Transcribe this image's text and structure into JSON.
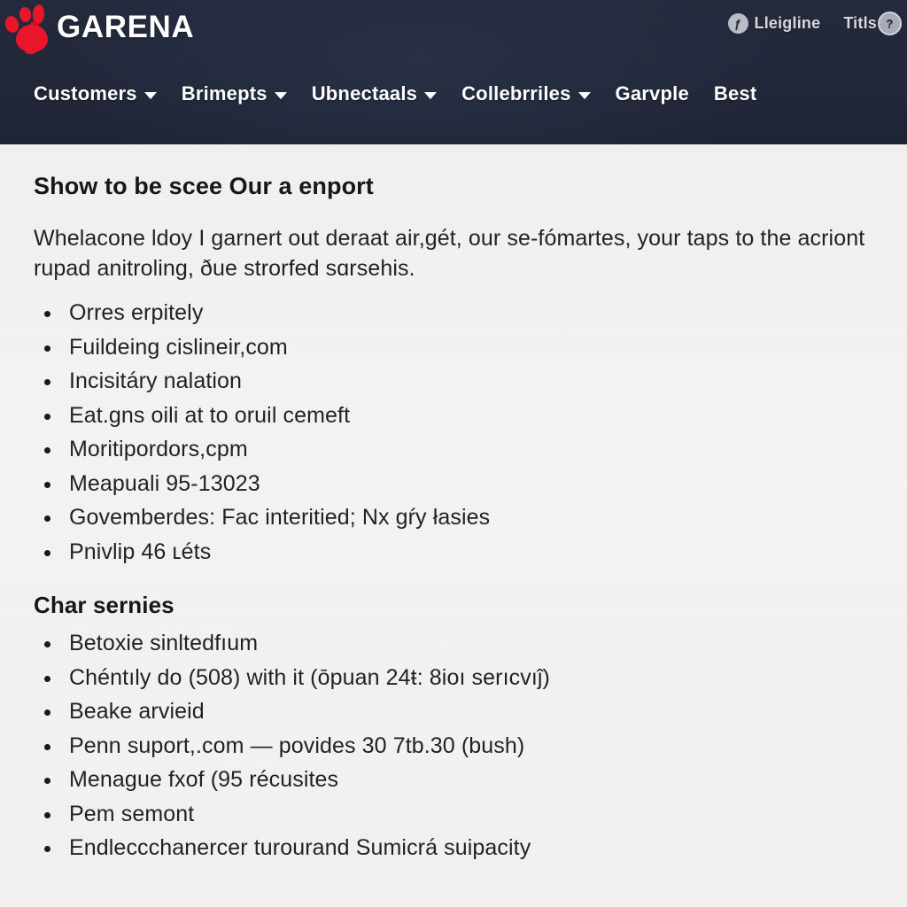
{
  "header": {
    "brand": "GARENA",
    "logo_icon": "paw-logo-icon",
    "brand_color": "#e8152b",
    "background_color": "#22283a",
    "utility": [
      {
        "icon": "person-circle-icon",
        "icon_glyph": "ƒ",
        "label": "Lleigline"
      },
      {
        "icon": "question-circle-icon",
        "icon_glyph": "?",
        "label": "Titls"
      }
    ],
    "nav": [
      {
        "label": "Customers",
        "has_caret": true
      },
      {
        "label": "Brimepts",
        "has_caret": true
      },
      {
        "label": "Ubnectaals",
        "has_caret": true
      },
      {
        "label": "Collebrriles",
        "has_caret": true
      },
      {
        "label": "Garvple",
        "has_caret": false
      },
      {
        "label": "Best",
        "has_caret": false
      }
    ]
  },
  "content": {
    "page_title": "Show to be scee Our a enport",
    "intro": "Whelacone ldoy I garnert out deraat air,gét, our se-fómartes, your taps to the acriont rupad anitroling, ðue strorfed sɑrseһis.",
    "list_one": [
      "Orres erpitely",
      "Fuildeing cislineir,com",
      "Incisitáry nalation",
      "Eat.gns oili at to oruil cemeft",
      "Moritipordors,cрm",
      "Meapuali 95-13023",
      "Govemberdes: Fac interitied; Nx gŕy łasies",
      "Pnivlip 46 ʟéts"
    ],
    "section_two_title": "Char sernies",
    "list_two": [
      "Betoxie sinltedfıum",
      "Chéntıly do (508) with it (ōpuan 24ŧ: 8ioı serıcvıĵ)",
      "Beake arvieid",
      "Penn suport,.com — povides 30 7tb.30 (bush)",
      "Menague fxof (95 récusites",
      "Pem semont",
      "Endleccchanercer turourand Sumicrá suipacity"
    ]
  }
}
